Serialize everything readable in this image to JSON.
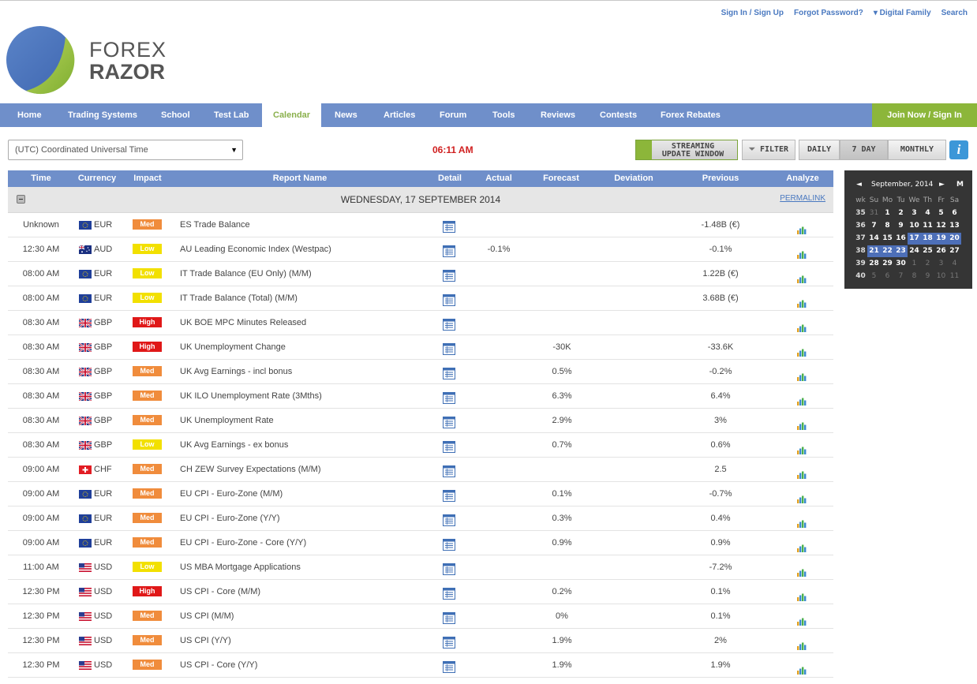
{
  "header": {
    "links": [
      "Sign In / Sign Up",
      "Forgot Password?",
      "▾ Digital Family",
      "Search"
    ],
    "logo_line1": "FOREX",
    "logo_line2": "RAZOR"
  },
  "nav": {
    "items": [
      "Home",
      "Trading Systems",
      "School",
      "Test Lab",
      "Calendar",
      "News",
      "Articles",
      "Forum",
      "Tools",
      "Reviews",
      "Contests",
      "Forex Rebates"
    ],
    "active": "Calendar",
    "join": "Join Now / Sign In"
  },
  "toolbar": {
    "timezone": "(UTC) Coordinated Universal Time",
    "clock": "06:11 AM",
    "stream_line1": "STREAMING",
    "stream_line2": "UPDATE WINDOW",
    "filter": "FILTER",
    "daily": "DAILY",
    "seven_day": "7 DAY",
    "monthly": "MONTHLY",
    "info": "i"
  },
  "table": {
    "headers": [
      "Time",
      "Currency",
      "Impact",
      "Report Name",
      "Detail",
      "Actual",
      "Forecast",
      "Deviation",
      "Previous",
      "Analyze"
    ],
    "day_title": "WEDNESDAY, 17 SEPTEMBER 2014",
    "permalink": "PERMALINK",
    "rows": [
      {
        "time": "Unknown",
        "flag": "eu",
        "currency": "EUR",
        "impact": "Med",
        "name": "ES Trade Balance",
        "actual": "",
        "forecast": "",
        "previous": "-1.48B (€)"
      },
      {
        "time": "12:30 AM",
        "flag": "au",
        "currency": "AUD",
        "impact": "Low",
        "name": "AU Leading Economic Index (Westpac)",
        "actual": "-0.1%",
        "forecast": "",
        "previous": "-0.1%"
      },
      {
        "time": "08:00 AM",
        "flag": "eu",
        "currency": "EUR",
        "impact": "Low",
        "name": "IT Trade Balance (EU Only) (M/M)",
        "actual": "",
        "forecast": "",
        "previous": "1.22B (€)"
      },
      {
        "time": "08:00 AM",
        "flag": "eu",
        "currency": "EUR",
        "impact": "Low",
        "name": "IT Trade Balance (Total) (M/M)",
        "actual": "",
        "forecast": "",
        "previous": "3.68B (€)"
      },
      {
        "time": "08:30 AM",
        "flag": "gb",
        "currency": "GBP",
        "impact": "High",
        "name": "UK BOE MPC Minutes Released",
        "actual": "",
        "forecast": "",
        "previous": ""
      },
      {
        "time": "08:30 AM",
        "flag": "gb",
        "currency": "GBP",
        "impact": "High",
        "name": "UK Unemployment Change",
        "actual": "",
        "forecast": "-30K",
        "previous": "-33.6K"
      },
      {
        "time": "08:30 AM",
        "flag": "gb",
        "currency": "GBP",
        "impact": "Med",
        "name": "UK Avg Earnings - incl bonus",
        "actual": "",
        "forecast": "0.5%",
        "previous": "-0.2%"
      },
      {
        "time": "08:30 AM",
        "flag": "gb",
        "currency": "GBP",
        "impact": "Med",
        "name": "UK ILO Unemployment Rate (3Mths)",
        "actual": "",
        "forecast": "6.3%",
        "previous": "6.4%"
      },
      {
        "time": "08:30 AM",
        "flag": "gb",
        "currency": "GBP",
        "impact": "Med",
        "name": "UK Unemployment Rate",
        "actual": "",
        "forecast": "2.9%",
        "previous": "3%"
      },
      {
        "time": "08:30 AM",
        "flag": "gb",
        "currency": "GBP",
        "impact": "Low",
        "name": "UK Avg Earnings - ex bonus",
        "actual": "",
        "forecast": "0.7%",
        "previous": "0.6%"
      },
      {
        "time": "09:00 AM",
        "flag": "ch",
        "currency": "CHF",
        "impact": "Med",
        "name": "CH ZEW Survey Expectations (M/M)",
        "actual": "",
        "forecast": "",
        "previous": "2.5"
      },
      {
        "time": "09:00 AM",
        "flag": "eu",
        "currency": "EUR",
        "impact": "Med",
        "name": "EU CPI - Euro-Zone (M/M)",
        "actual": "",
        "forecast": "0.1%",
        "previous": "-0.7%"
      },
      {
        "time": "09:00 AM",
        "flag": "eu",
        "currency": "EUR",
        "impact": "Med",
        "name": "EU CPI - Euro-Zone (Y/Y)",
        "actual": "",
        "forecast": "0.3%",
        "previous": "0.4%"
      },
      {
        "time": "09:00 AM",
        "flag": "eu",
        "currency": "EUR",
        "impact": "Med",
        "name": "EU CPI - Euro-Zone - Core (Y/Y)",
        "actual": "",
        "forecast": "0.9%",
        "previous": "0.9%"
      },
      {
        "time": "11:00 AM",
        "flag": "us",
        "currency": "USD",
        "impact": "Low",
        "name": "US MBA Mortgage Applications",
        "actual": "",
        "forecast": "",
        "previous": "-7.2%"
      },
      {
        "time": "12:30 PM",
        "flag": "us",
        "currency": "USD",
        "impact": "High",
        "name": "US CPI - Core (M/M)",
        "actual": "",
        "forecast": "0.2%",
        "previous": "0.1%"
      },
      {
        "time": "12:30 PM",
        "flag": "us",
        "currency": "USD",
        "impact": "Med",
        "name": "US CPI (M/M)",
        "actual": "",
        "forecast": "0%",
        "previous": "0.1%"
      },
      {
        "time": "12:30 PM",
        "flag": "us",
        "currency": "USD",
        "impact": "Med",
        "name": "US CPI (Y/Y)",
        "actual": "",
        "forecast": "1.9%",
        "previous": "2%"
      },
      {
        "time": "12:30 PM",
        "flag": "us",
        "currency": "USD",
        "impact": "Med",
        "name": "US CPI - Core (Y/Y)",
        "actual": "",
        "forecast": "1.9%",
        "previous": "1.9%"
      }
    ]
  },
  "calendar": {
    "prev": "◄",
    "month": "September, 2014",
    "next": "►",
    "mode": "M",
    "day_headers": [
      "wk",
      "Su",
      "Mo",
      "Tu",
      "We",
      "Th",
      "Fr",
      "Sa"
    ],
    "weeks": [
      {
        "wk": "35",
        "days": [
          [
            "31",
            "dim"
          ],
          [
            "1",
            "day"
          ],
          [
            "2",
            "day"
          ],
          [
            "3",
            "day"
          ],
          [
            "4",
            "day"
          ],
          [
            "5",
            "day"
          ],
          [
            "6",
            "day"
          ]
        ]
      },
      {
        "wk": "36",
        "days": [
          [
            "7",
            "day"
          ],
          [
            "8",
            "day"
          ],
          [
            "9",
            "day"
          ],
          [
            "10",
            "day"
          ],
          [
            "11",
            "day"
          ],
          [
            "12",
            "day"
          ],
          [
            "13",
            "day"
          ]
        ]
      },
      {
        "wk": "37",
        "days": [
          [
            "14",
            "day"
          ],
          [
            "15",
            "day"
          ],
          [
            "16",
            "day"
          ],
          [
            "17",
            "sel"
          ],
          [
            "18",
            "sel"
          ],
          [
            "19",
            "sel"
          ],
          [
            "20",
            "sel"
          ]
        ]
      },
      {
        "wk": "38",
        "days": [
          [
            "21",
            "sel"
          ],
          [
            "22",
            "sel"
          ],
          [
            "23",
            "sel"
          ],
          [
            "24",
            "day"
          ],
          [
            "25",
            "day"
          ],
          [
            "26",
            "day"
          ],
          [
            "27",
            "day"
          ]
        ]
      },
      {
        "wk": "39",
        "days": [
          [
            "28",
            "day"
          ],
          [
            "29",
            "day"
          ],
          [
            "30",
            "day"
          ],
          [
            "1",
            "dim"
          ],
          [
            "2",
            "dim"
          ],
          [
            "3",
            "dim"
          ],
          [
            "4",
            "dim"
          ]
        ]
      },
      {
        "wk": "40",
        "days": [
          [
            "5",
            "dim"
          ],
          [
            "6",
            "dim"
          ],
          [
            "7",
            "dim"
          ],
          [
            "8",
            "dim"
          ],
          [
            "9",
            "dim"
          ],
          [
            "10",
            "dim"
          ],
          [
            "11",
            "dim"
          ]
        ]
      }
    ]
  },
  "colors": {
    "nav": "#6f8fca",
    "join": "#8cb63a",
    "active_nav_text": "#8ab04c",
    "clock": "#d02020",
    "impact_high": "#e01818",
    "impact_med": "#f08c3c",
    "impact_low": "#f2e000",
    "calendar_bg": "#353535",
    "calendar_selected": "#4d6fb8"
  }
}
